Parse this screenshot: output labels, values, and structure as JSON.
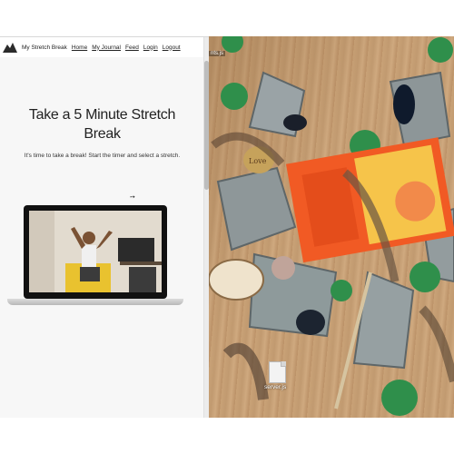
{
  "nav": {
    "brand": "My Stretch Break",
    "links": [
      "Home",
      "My Journal",
      "Feed",
      "Login",
      "Logout"
    ]
  },
  "main": {
    "title": "Take a 5 Minute Stretch Break",
    "subtitle": "It's time to take a break! Start the timer and select a stretch.",
    "arrow": "➙"
  },
  "desktop": {
    "top_file_label": "nts.js",
    "file_name": "server.js"
  },
  "colors": {
    "accent_orange": "#f15a24",
    "marble_green": "#2f8f4b",
    "wood": "#c9a277"
  }
}
